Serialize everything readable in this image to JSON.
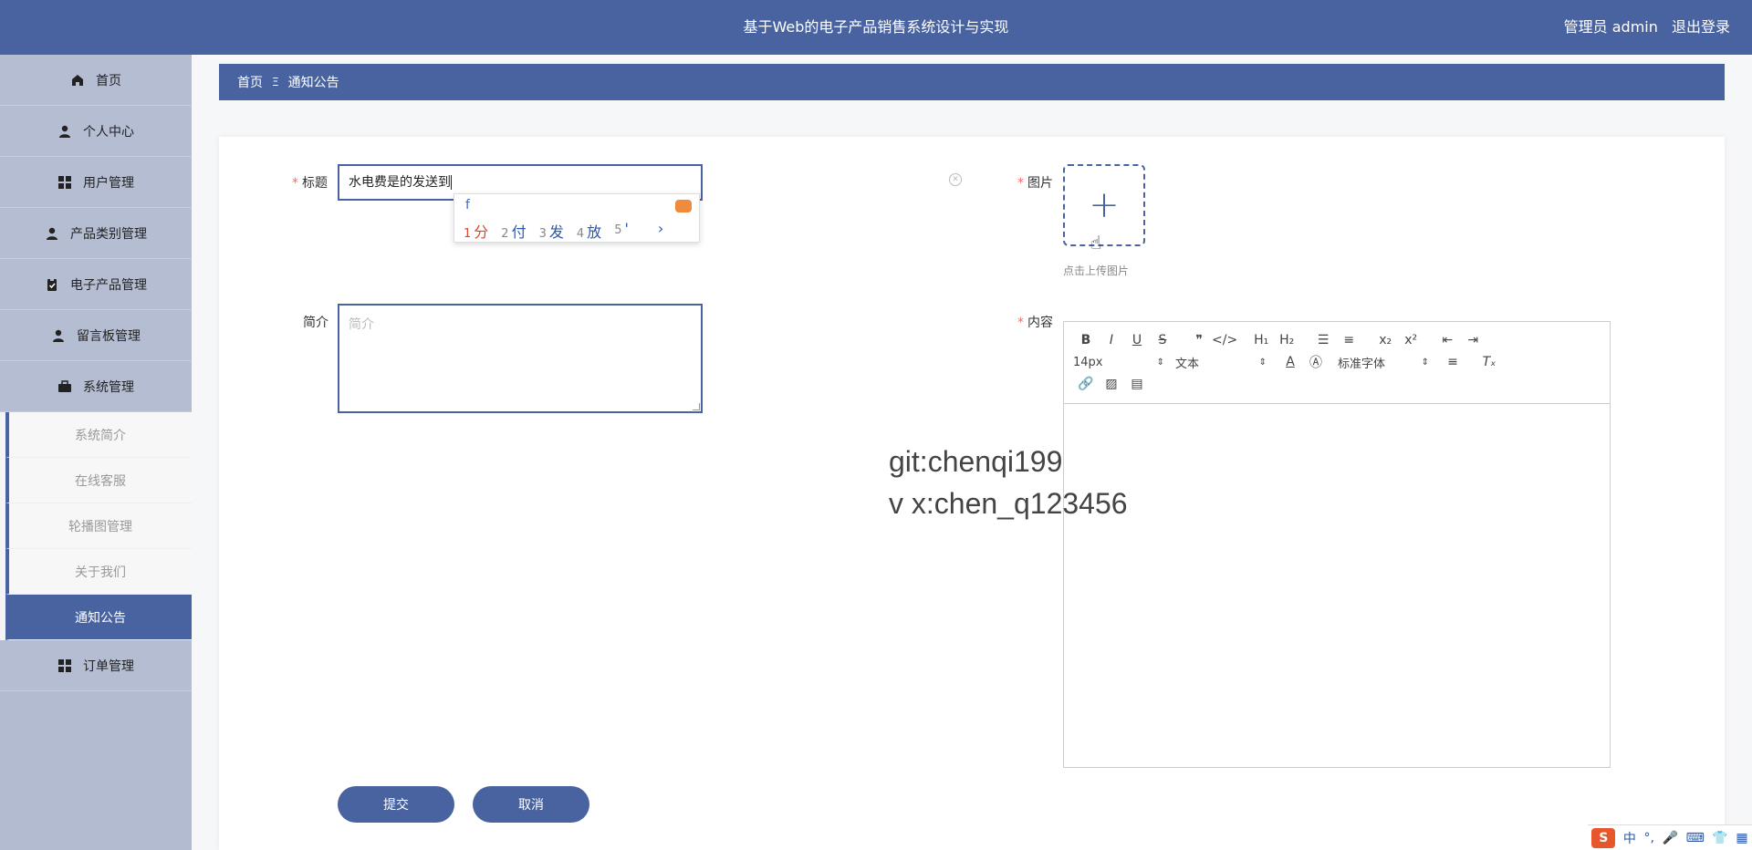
{
  "header": {
    "title": "基于Web的电子产品销售系统设计与实现",
    "user": "管理员 admin",
    "logout": "退出登录"
  },
  "sidebar": {
    "items": [
      {
        "label": "首页",
        "icon": "home-icon"
      },
      {
        "label": "个人中心",
        "icon": "person-icon"
      },
      {
        "label": "用户管理",
        "icon": "grid-icon"
      },
      {
        "label": "产品类别管理",
        "icon": "person-icon"
      },
      {
        "label": "电子产品管理",
        "icon": "clipboard-icon"
      },
      {
        "label": "留言板管理",
        "icon": "person-icon"
      },
      {
        "label": "系统管理",
        "icon": "briefcase-icon"
      }
    ],
    "submenu": [
      "系统简介",
      "在线客服",
      "轮播图管理",
      "关于我们",
      "通知公告"
    ],
    "last": {
      "label": "订单管理",
      "icon": "grid-icon"
    }
  },
  "breadcrumb": {
    "home": "首页",
    "sep": "Ξ",
    "current": "通知公告"
  },
  "form": {
    "title_label": "标题",
    "title_value": "水电费是的发送到",
    "intro_label": "简介",
    "intro_placeholder": "简介",
    "image_label": "图片",
    "upload_tip": "点击上传图片",
    "content_label": "内容",
    "submit": "提交",
    "cancel": "取消"
  },
  "ime": {
    "composition": "f",
    "candidates": [
      {
        "n": "1",
        "c": "分"
      },
      {
        "n": "2",
        "c": "付"
      },
      {
        "n": "3",
        "c": "发"
      },
      {
        "n": "4",
        "c": "放"
      },
      {
        "n": "5",
        "c": "'"
      }
    ],
    "status": [
      "中",
      "°,",
      "🎤",
      "⌨",
      "👕",
      "▦"
    ]
  },
  "editor": {
    "font_size": "14px",
    "block_type": "文本",
    "font_family": "标准字体"
  },
  "watermark": {
    "line1": "git:chenqi199",
    "line2": "v x:chen_q123456"
  },
  "colors": {
    "primary": "#4963a0",
    "sidebar": "#b4bdd1",
    "required": "#f56c6c"
  }
}
